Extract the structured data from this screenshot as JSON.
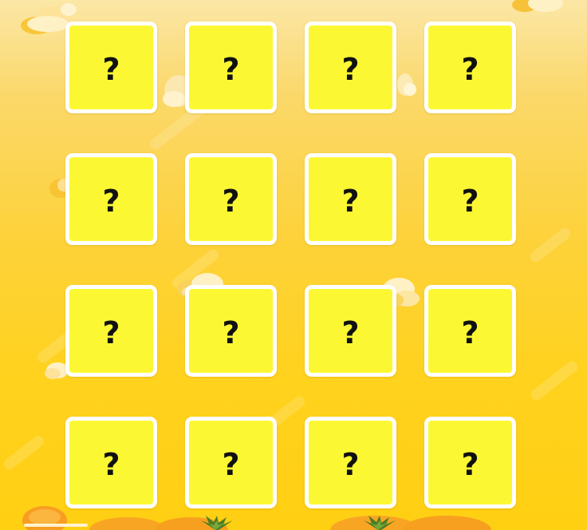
{
  "game": {
    "board": {
      "rows": 4,
      "columns": 4,
      "cards": [
        {
          "label": "?",
          "state": "face-down"
        },
        {
          "label": "?",
          "state": "face-down"
        },
        {
          "label": "?",
          "state": "face-down"
        },
        {
          "label": "?",
          "state": "face-down"
        },
        {
          "label": "?",
          "state": "face-down"
        },
        {
          "label": "?",
          "state": "face-down"
        },
        {
          "label": "?",
          "state": "face-down"
        },
        {
          "label": "?",
          "state": "face-down"
        },
        {
          "label": "?",
          "state": "face-down"
        },
        {
          "label": "?",
          "state": "face-down"
        },
        {
          "label": "?",
          "state": "face-down"
        },
        {
          "label": "?",
          "state": "face-down"
        },
        {
          "label": "?",
          "state": "face-down"
        },
        {
          "label": "?",
          "state": "face-down"
        },
        {
          "label": "?",
          "state": "face-down"
        },
        {
          "label": "?",
          "state": "face-down"
        }
      ]
    }
  },
  "colors": {
    "background_top": "#fbe7a6",
    "background_bottom": "#ffcf12",
    "card_face": "#fbf833",
    "card_border": "#ffffff",
    "label": "#111111"
  },
  "decorations": {
    "clouds": [
      "cloud-icon",
      "cloud-icon",
      "cloud-icon",
      "cloud-icon",
      "cloud-icon",
      "cloud-icon",
      "cloud-icon",
      "cloud-icon"
    ],
    "ground": [
      "pumpkin-icon",
      "pumpkin-icon",
      "leaf-sprout-icon",
      "leaf-sprout-icon"
    ]
  }
}
